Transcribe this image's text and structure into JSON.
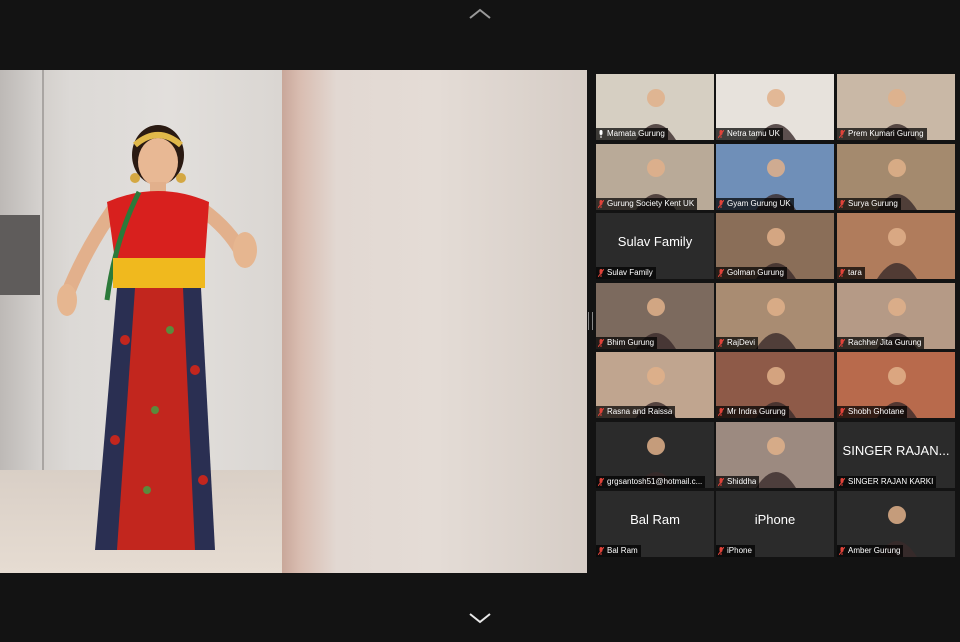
{
  "navigation": {
    "scroll_up_icon": "chevron-up-icon",
    "scroll_down_icon": "chevron-down-icon"
  },
  "speaker": {
    "description_icon": "active-speaker-video"
  },
  "participants": [
    {
      "name": "Mamata Gurung",
      "big": "",
      "active": true,
      "mic": "unmuted",
      "bg": "#d6cfc2"
    },
    {
      "name": "Netra tamu UK",
      "big": "",
      "mic": "muted",
      "bg": "#e7e2dc"
    },
    {
      "name": "Prem Kumari Gurung",
      "big": "",
      "mic": "muted",
      "bg": "#c9b8a6"
    },
    {
      "name": "Gurung Society Kent UK",
      "big": "",
      "mic": "muted",
      "bg": "#b9aa98"
    },
    {
      "name": "Gyam Gurung UK",
      "big": "",
      "mic": "muted",
      "bg": "#6f8fb8"
    },
    {
      "name": "Surya Gurung",
      "big": "",
      "mic": "muted",
      "bg": "#a48a6e"
    },
    {
      "name": "Sulav Family",
      "big": "Sulav Family",
      "mic": "muted",
      "bg": "#2b2b2b"
    },
    {
      "name": "Golman Gurung",
      "big": "",
      "mic": "muted",
      "bg": "#8a6e58"
    },
    {
      "name": "tara",
      "big": "",
      "mic": "muted",
      "bg": "#b07c5c"
    },
    {
      "name": "Bhim Gurung",
      "big": "",
      "mic": "muted",
      "bg": "#7c6a5e"
    },
    {
      "name": "RajDevi",
      "big": "",
      "mic": "muted",
      "bg": "#a98c72"
    },
    {
      "name": "Rachhe/ Jita Gurung",
      "big": "",
      "mic": "muted",
      "bg": "#b59a86"
    },
    {
      "name": "Rasna and Raissa",
      "big": "",
      "mic": "muted",
      "bg": "#c0a58f"
    },
    {
      "name": "Mr Indra Gurung",
      "big": "",
      "mic": "muted",
      "bg": "#8e5a48"
    },
    {
      "name": "Shobh Ghotane",
      "big": "",
      "mic": "muted",
      "bg": "#b86a4c"
    },
    {
      "name": "grgsantosh51@hotmail.c...",
      "big": "",
      "mic": "muted",
      "bg": "#2b2b2b"
    },
    {
      "name": "Shiddha",
      "big": "",
      "mic": "muted",
      "bg": "#9c8a80"
    },
    {
      "name": "SINGER RAJAN KARKI",
      "big": "SINGER RAJAN...",
      "mic": "muted",
      "bg": "#2b2b2b"
    },
    {
      "name": "Bal Ram",
      "big": "Bal Ram",
      "mic": "muted",
      "bg": "#2b2b2b"
    },
    {
      "name": "iPhone",
      "big": "iPhone",
      "mic": "muted",
      "bg": "#2b2b2b"
    },
    {
      "name": "Amber Gurung",
      "big": "",
      "mic": "muted",
      "bg": "#2b2b2b"
    }
  ],
  "colors": {
    "active_border": "#c8e36c",
    "muted_mic": "#e0433a",
    "background": "#131313"
  }
}
